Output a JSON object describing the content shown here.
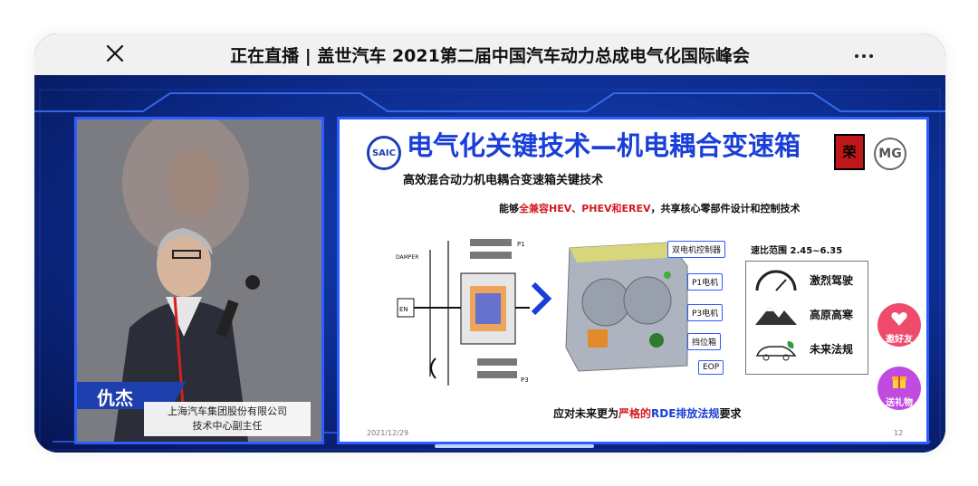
{
  "topbar": {
    "title": "正在直播 | 盖世汽车 2021第二届中国汽车动力总成电气化国际峰会",
    "close_icon": "close-icon",
    "more_icon": "more-icon"
  },
  "speaker": {
    "name": "仇杰",
    "company": "上海汽车集团股份有限公司",
    "position": "技术中心副主任"
  },
  "slide": {
    "saic_logo": "SAIC",
    "roewe_logo": "荣",
    "mg_logo": "MG",
    "title": "电气化关键技术—机电耦合变速箱",
    "subtitle": "高效混合动力机电耦合变速箱关键技术",
    "compat_prefix": "能够",
    "compat_red": "全兼容HEV、PHEV和EREV",
    "compat_suffix": "，共享核心零部件设计和控制技术",
    "diagram": {
      "p1": "P1",
      "p3": "P3",
      "damper": "DAMPER",
      "en": "EN"
    },
    "callouts": [
      "双电机控制器",
      "P1电机",
      "P3电机",
      "挡位箱",
      "EOP"
    ],
    "speed_range": "速比范围 2.45~6.35",
    "features": [
      "激烈驾驶",
      "高原高寒",
      "未来法规"
    ],
    "footer_prefix": "应对未来更为",
    "footer_red": "严格的",
    "footer_blue": "RDE排放法规",
    "footer_suffix": "要求",
    "date": "2021/12/29",
    "page": "12"
  },
  "float_buttons": [
    {
      "label": "邀好友",
      "color": "#ef4b6c"
    },
    {
      "label": "送礼物",
      "color": "#c14be0"
    }
  ],
  "colors": {
    "accent": "#1a3fd8",
    "red": "#d3191f",
    "stage": "#0c2a8a"
  }
}
